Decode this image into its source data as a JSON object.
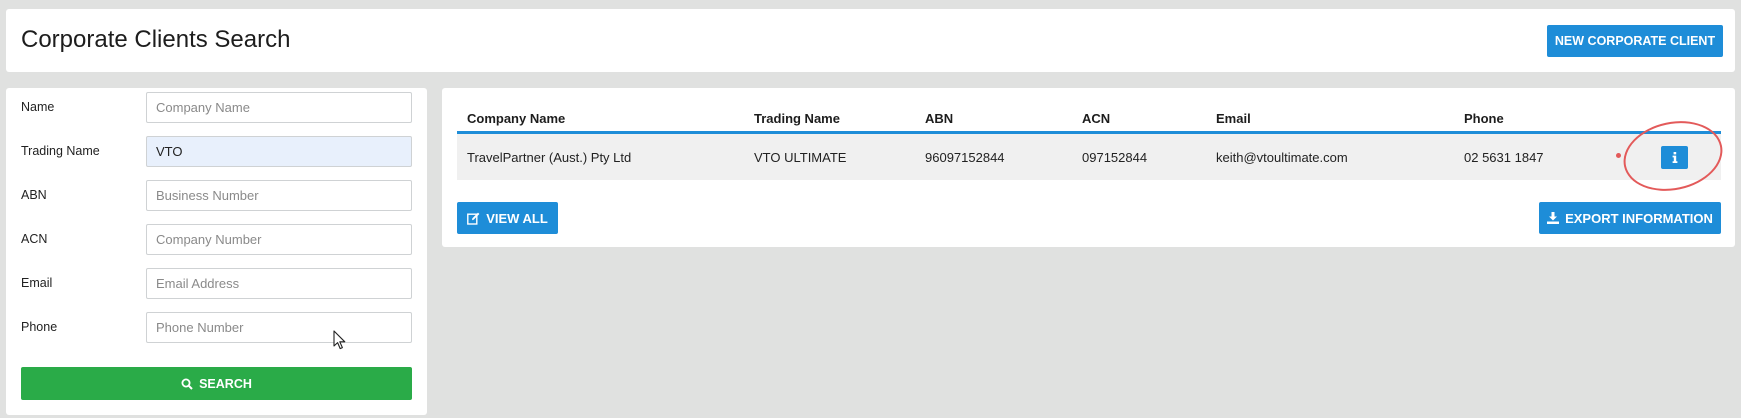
{
  "header": {
    "title": "Corporate Clients Search",
    "new_button_label": "NEW CORPORATE CLIENT"
  },
  "search": {
    "fields": [
      {
        "label": "Name",
        "value": "",
        "placeholder": "Company Name"
      },
      {
        "label": "Trading Name",
        "value": "VTO",
        "placeholder": ""
      },
      {
        "label": "ABN",
        "value": "",
        "placeholder": "Business Number"
      },
      {
        "label": "ACN",
        "value": "",
        "placeholder": "Company Number"
      },
      {
        "label": "Email",
        "value": "",
        "placeholder": "Email Address"
      },
      {
        "label": "Phone",
        "value": "",
        "placeholder": "Phone Number"
      }
    ],
    "search_button_label": "SEARCH"
  },
  "results": {
    "columns": [
      "Company Name",
      "Trading Name",
      "ABN",
      "ACN",
      "Email",
      "Phone"
    ],
    "rows": [
      {
        "company_name": "TravelPartner (Aust.) Pty Ltd",
        "trading_name": "VTO ULTIMATE",
        "abn": "96097152844",
        "acn": "097152844",
        "email": "keith@vtoultimate.com",
        "phone": "02 5631 1847"
      }
    ],
    "view_all_label": "VIEW ALL",
    "export_label": "EXPORT INFORMATION"
  },
  "icons": {
    "search": "search-icon",
    "view_all": "edit-icon",
    "export": "download-icon",
    "info": "info-icon"
  },
  "colors": {
    "primary": "#1e8dd8",
    "success": "#2aab48",
    "annotation": "#e35a5a",
    "background": "#e0e1e0"
  }
}
